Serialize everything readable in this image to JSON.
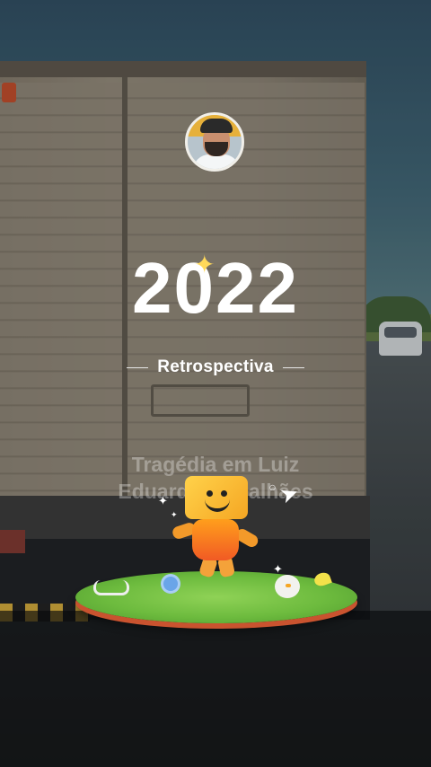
{
  "story": {
    "year": "2022",
    "subtitle": "Retrospectiva",
    "caption_line1": "Tragédia em Luiz",
    "caption_line2": "Eduardo Magalhães"
  },
  "profile": {
    "avatar_icon": "user-avatar"
  },
  "illustration": {
    "mascot_icon": "smiling-cube-mascot",
    "plane_icon": "paper-plane-icon",
    "sparkle_icon": "sparkle-icon"
  },
  "colors": {
    "accent_yellow": "#ffd95a",
    "mascot_orange": "#f5a623",
    "grass_green": "#6dbb3e"
  }
}
